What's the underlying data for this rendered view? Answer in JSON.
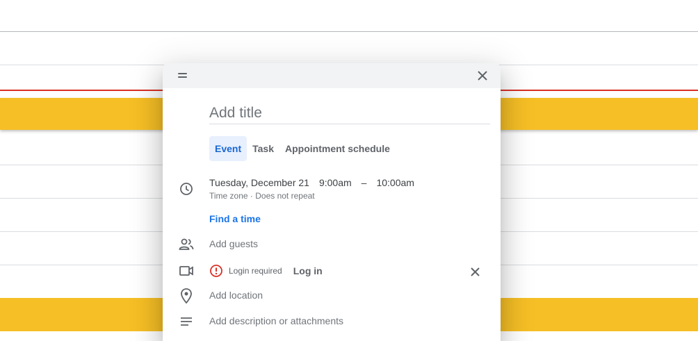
{
  "dialog": {
    "title_placeholder": "Add title",
    "tabs": [
      {
        "label": "Event",
        "active": true
      },
      {
        "label": "Task",
        "active": false
      },
      {
        "label": "Appointment schedule",
        "active": false
      }
    ],
    "datetime": {
      "date": "Tuesday, December 21",
      "start": "9:00am",
      "separator": "–",
      "end": "10:00am"
    },
    "timezone_text": "Time zone · Does not repeat",
    "find_time_label": "Find a time",
    "guests_placeholder": "Add guests",
    "conferencing": {
      "status": "Login required",
      "login_label": "Log in"
    },
    "location_placeholder": "Add location",
    "description_placeholder": "Add description or attachments"
  },
  "icons": {
    "drag": "drag-handle-icon",
    "close": "close-icon",
    "clock": "clock-icon",
    "guests": "people-icon",
    "video": "video-camera-icon",
    "alert": "alert-circle-icon",
    "location": "location-pin-icon",
    "description": "notes-icon"
  },
  "colors": {
    "event_block": "#f6bf26",
    "now_indicator": "#d93025",
    "accent_blue": "#1a73e8",
    "active_tab_bg": "#e8f0fe",
    "alert_red": "#d93025"
  }
}
